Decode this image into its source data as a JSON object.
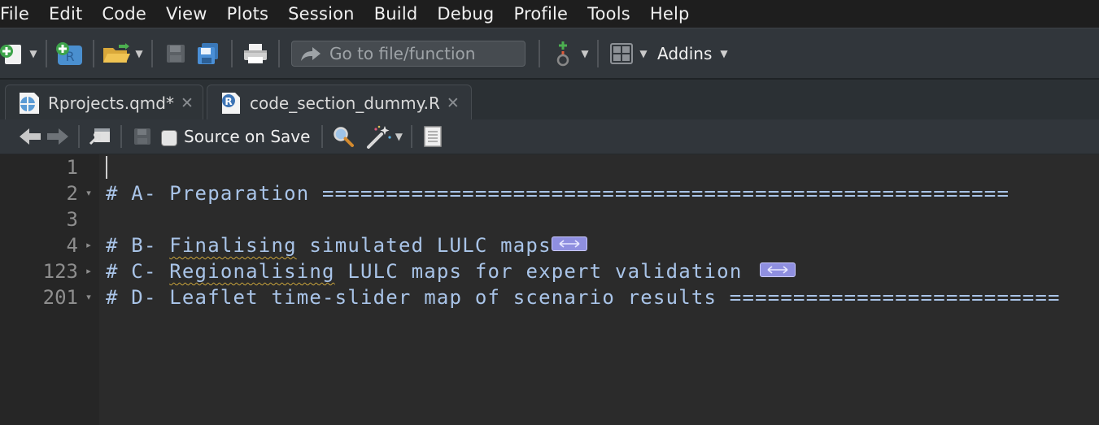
{
  "menu": [
    "File",
    "Edit",
    "Code",
    "View",
    "Plots",
    "Session",
    "Build",
    "Debug",
    "Profile",
    "Tools",
    "Help"
  ],
  "toolbar": {
    "goto_placeholder": "Go to file/function",
    "addins_label": "Addins"
  },
  "tabs": [
    {
      "name": "Rprojects.qmd*",
      "icon": "quarto-file-icon",
      "active": false,
      "close": "✕"
    },
    {
      "name": "code_section_dummy.R",
      "icon": "r-file-icon",
      "active": true,
      "close": "✕"
    }
  ],
  "editor_toolbar": {
    "source_on_save_label": "Source on Save"
  },
  "editor": {
    "lines": [
      {
        "number": "1",
        "fold": "",
        "text": ""
      },
      {
        "number": "2",
        "fold": "▾",
        "text": "# A- Preparation ======================================================"
      },
      {
        "number": "3",
        "fold": "",
        "text": ""
      },
      {
        "number": "4",
        "fold": "▸",
        "text_prefix": "# B- ",
        "text_squiggle": "Finalising",
        "text_suffix": " simulated LULC maps",
        "folded": true
      },
      {
        "number": "123",
        "fold": "▸",
        "text_prefix": "# C- ",
        "text_squiggle": "Regionalising",
        "text_suffix": " LULC maps for expert validation ",
        "folded": true
      },
      {
        "number": "201",
        "fold": "▾",
        "text": "# D- Leaflet time-slider map of scenario results =========================="
      }
    ]
  },
  "colors": {
    "code_comment": "#a9c4e8",
    "fold_marker": "#8f8fe0",
    "editor_bg": "#2b2b2b",
    "gutter_bg": "#262626"
  }
}
